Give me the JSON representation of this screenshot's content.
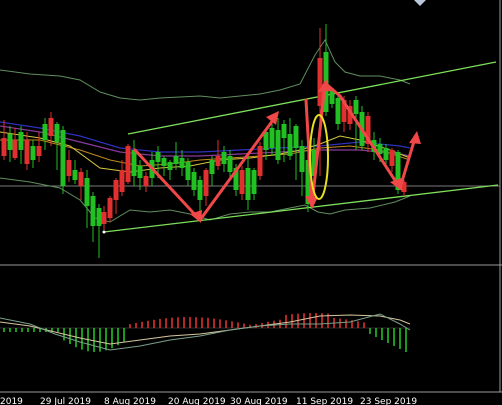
{
  "colors": {
    "background": "#000000",
    "bull_candle": "#22c022",
    "bear_candle": "#e03030",
    "bollinger": "#5f8f5f",
    "channel": "#7ee05a",
    "arrows": "#f04848",
    "ellipse": "#e6e020",
    "ma_blue": "#3030c0",
    "ma_purple": "#8a3a9a",
    "ma_orange": "#c08a20",
    "ma_yellow": "#d8c840",
    "hist_up": "#e03030",
    "hist_down": "#22c022",
    "osc_signal": "#d8c8a0",
    "osc_main": "#7aa08a"
  },
  "annotations": {
    "channel": "upward channel",
    "zigzag": "swing arrows",
    "ellipse": "highlighted candle"
  },
  "x_axis": {
    "labels": [
      "2019",
      "29 Jul 2019",
      "8 Aug 2019",
      "20 Aug 2019",
      "30 Aug 2019",
      "11 Sep 2019",
      "23 Sep 2019"
    ]
  },
  "panels": {
    "main": "price",
    "sub": "oscillator"
  }
}
